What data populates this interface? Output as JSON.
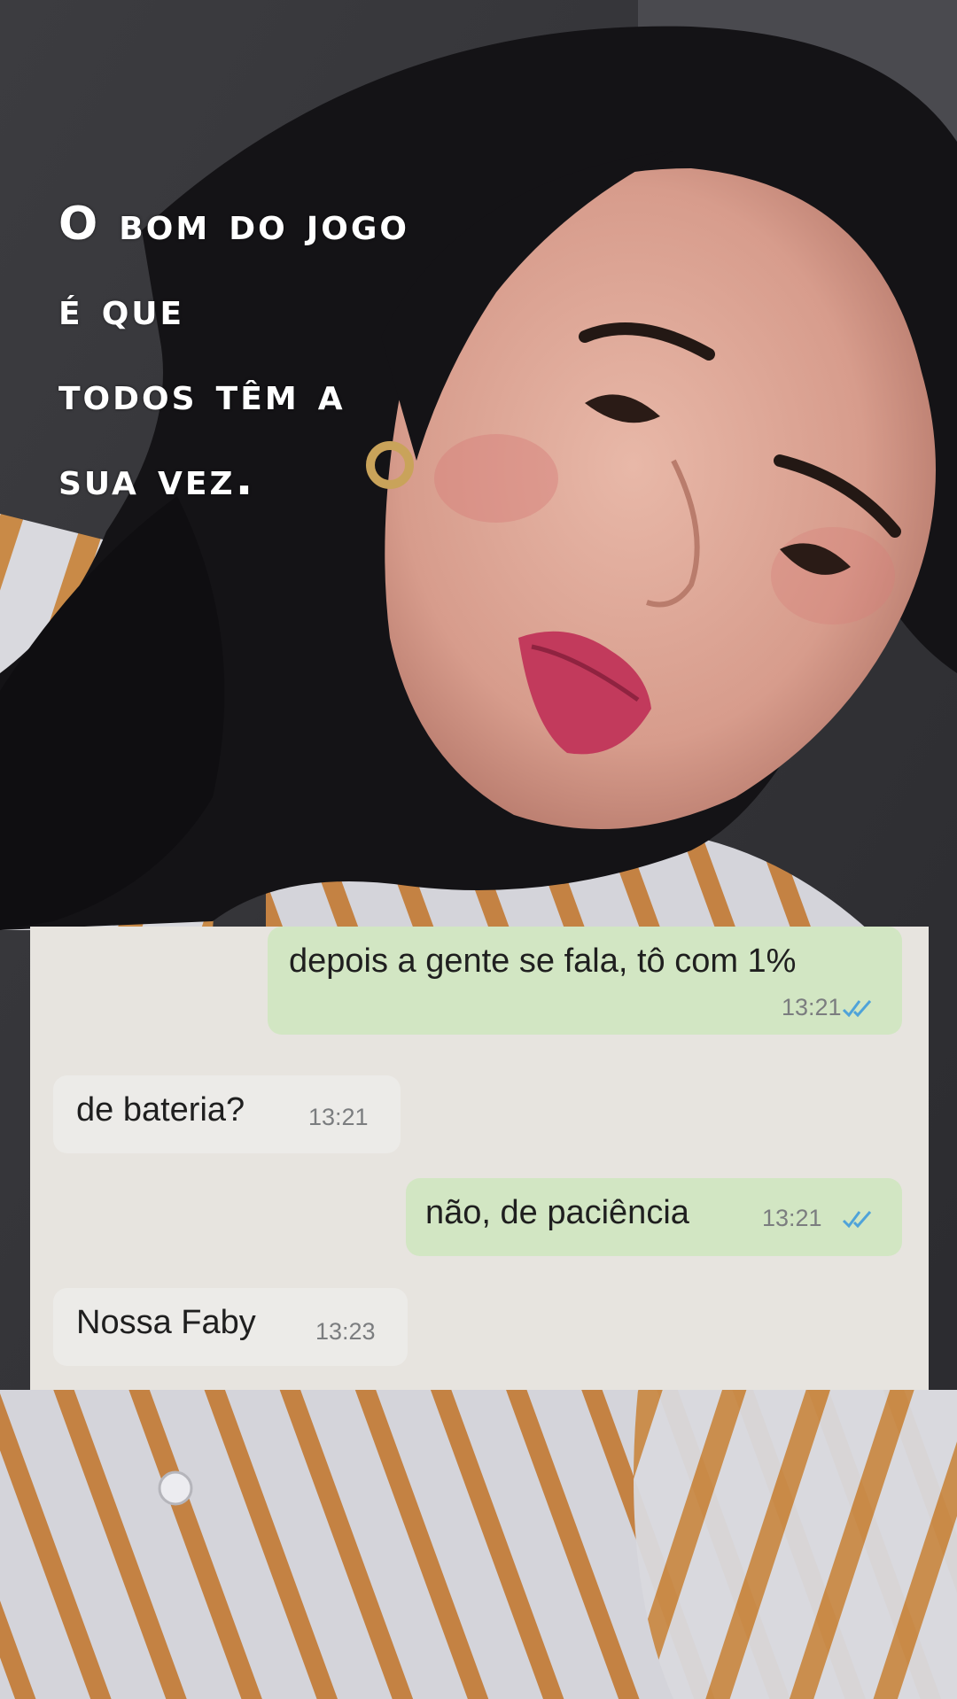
{
  "caption": {
    "lines": [
      "O bom do jogo",
      "é que",
      "todos têm a",
      "sua vez."
    ]
  },
  "chat": {
    "messages": [
      {
        "direction": "outgoing",
        "text": "depois a gente se fala, tô com 1%",
        "time": "13:21",
        "status": "read",
        "status_icon": "double-check-icon"
      },
      {
        "direction": "incoming",
        "text": "de bateria?",
        "time": "13:21"
      },
      {
        "direction": "outgoing",
        "text": "não, de paciência",
        "time": "13:21",
        "status": "read",
        "status_icon": "double-check-icon"
      },
      {
        "direction": "incoming",
        "text": "Nossa Faby",
        "time": "13:23"
      }
    ]
  },
  "colors": {
    "outgoing_bubble": "#d2e6c3",
    "incoming_bubble": "#ecebe8",
    "chat_background": "#e7e4df",
    "read_ticks": "#4fa3d9",
    "caption_text": "#ffffff",
    "shirt_stripe": "#c98a47"
  }
}
